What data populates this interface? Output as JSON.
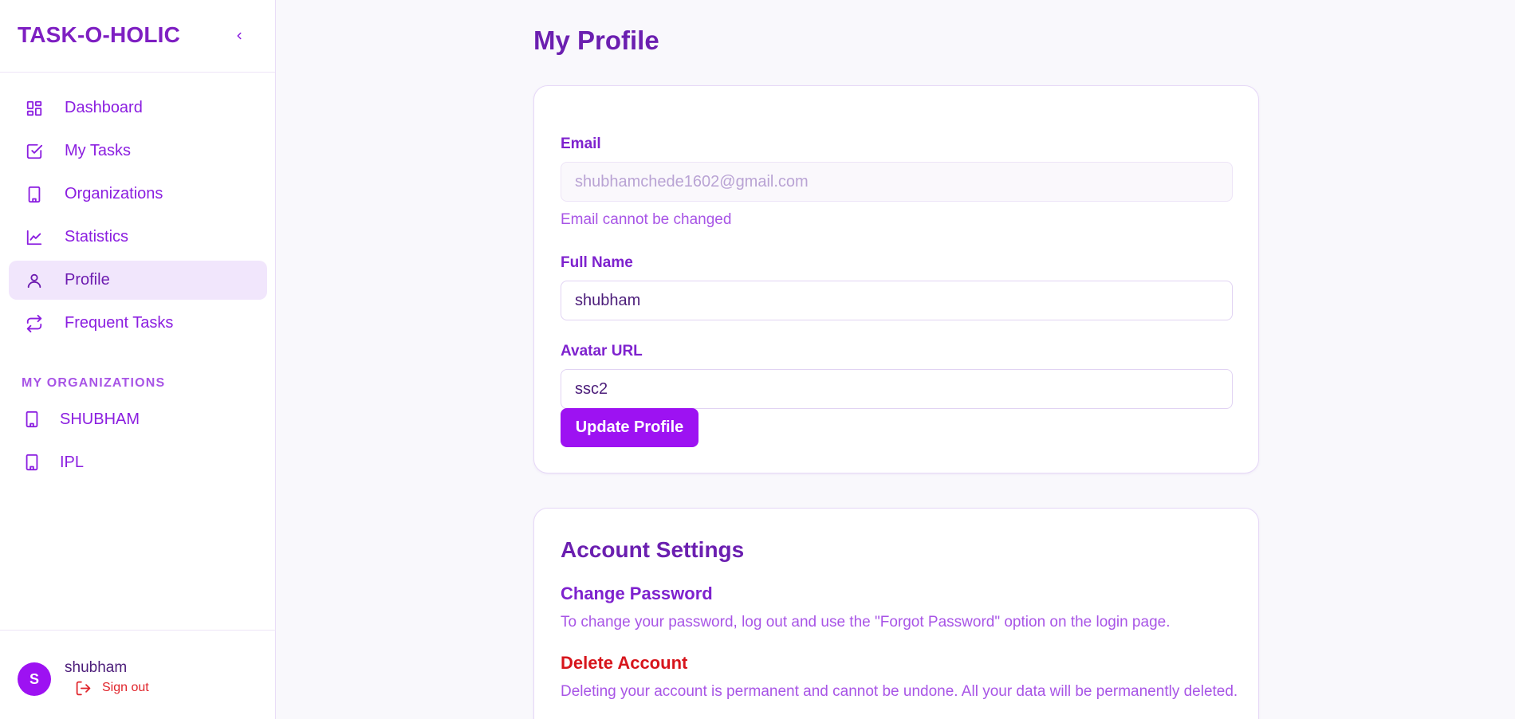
{
  "sidebar": {
    "brand": "TASK-O-HOLIC",
    "nav": [
      {
        "label": "Dashboard",
        "icon": "dashboard-icon"
      },
      {
        "label": "My Tasks",
        "icon": "checkbox-icon"
      },
      {
        "label": "Organizations",
        "icon": "building-icon"
      },
      {
        "label": "Statistics",
        "icon": "chart-icon"
      },
      {
        "label": "Profile",
        "icon": "user-icon",
        "active": true
      },
      {
        "label": "Frequent Tasks",
        "icon": "repeat-icon"
      }
    ],
    "orgs_heading": "MY ORGANIZATIONS",
    "orgs": [
      {
        "label": "SHUBHAM",
        "icon": "building-icon"
      },
      {
        "label": "IPL",
        "icon": "building-icon"
      }
    ],
    "user": {
      "initial": "S",
      "name": "shubham",
      "signout_label": "Sign out"
    }
  },
  "main": {
    "title": "My Profile",
    "profile_form": {
      "email_label": "Email",
      "email_value": "shubhamchede1602@gmail.com",
      "email_hint": "Email cannot be changed",
      "fullname_label": "Full Name",
      "fullname_value": "shubham",
      "avatar_label": "Avatar URL",
      "avatar_value": "ssc2",
      "submit_label": "Update Profile"
    },
    "account_settings": {
      "title": "Account Settings",
      "change_password_heading": "Change Password",
      "change_password_text": "To change your password, log out and use the \"Forgot Password\" option on the login page.",
      "delete_heading": "Delete Account",
      "delete_text": "Deleting your account is permanent and cannot be undone. All your data will be permanently deleted."
    }
  },
  "colors": {
    "accent": "#9d12f2",
    "brand_text": "#7e1fc2",
    "danger": "#d7151c",
    "active_bg": "#f1e6fc"
  }
}
